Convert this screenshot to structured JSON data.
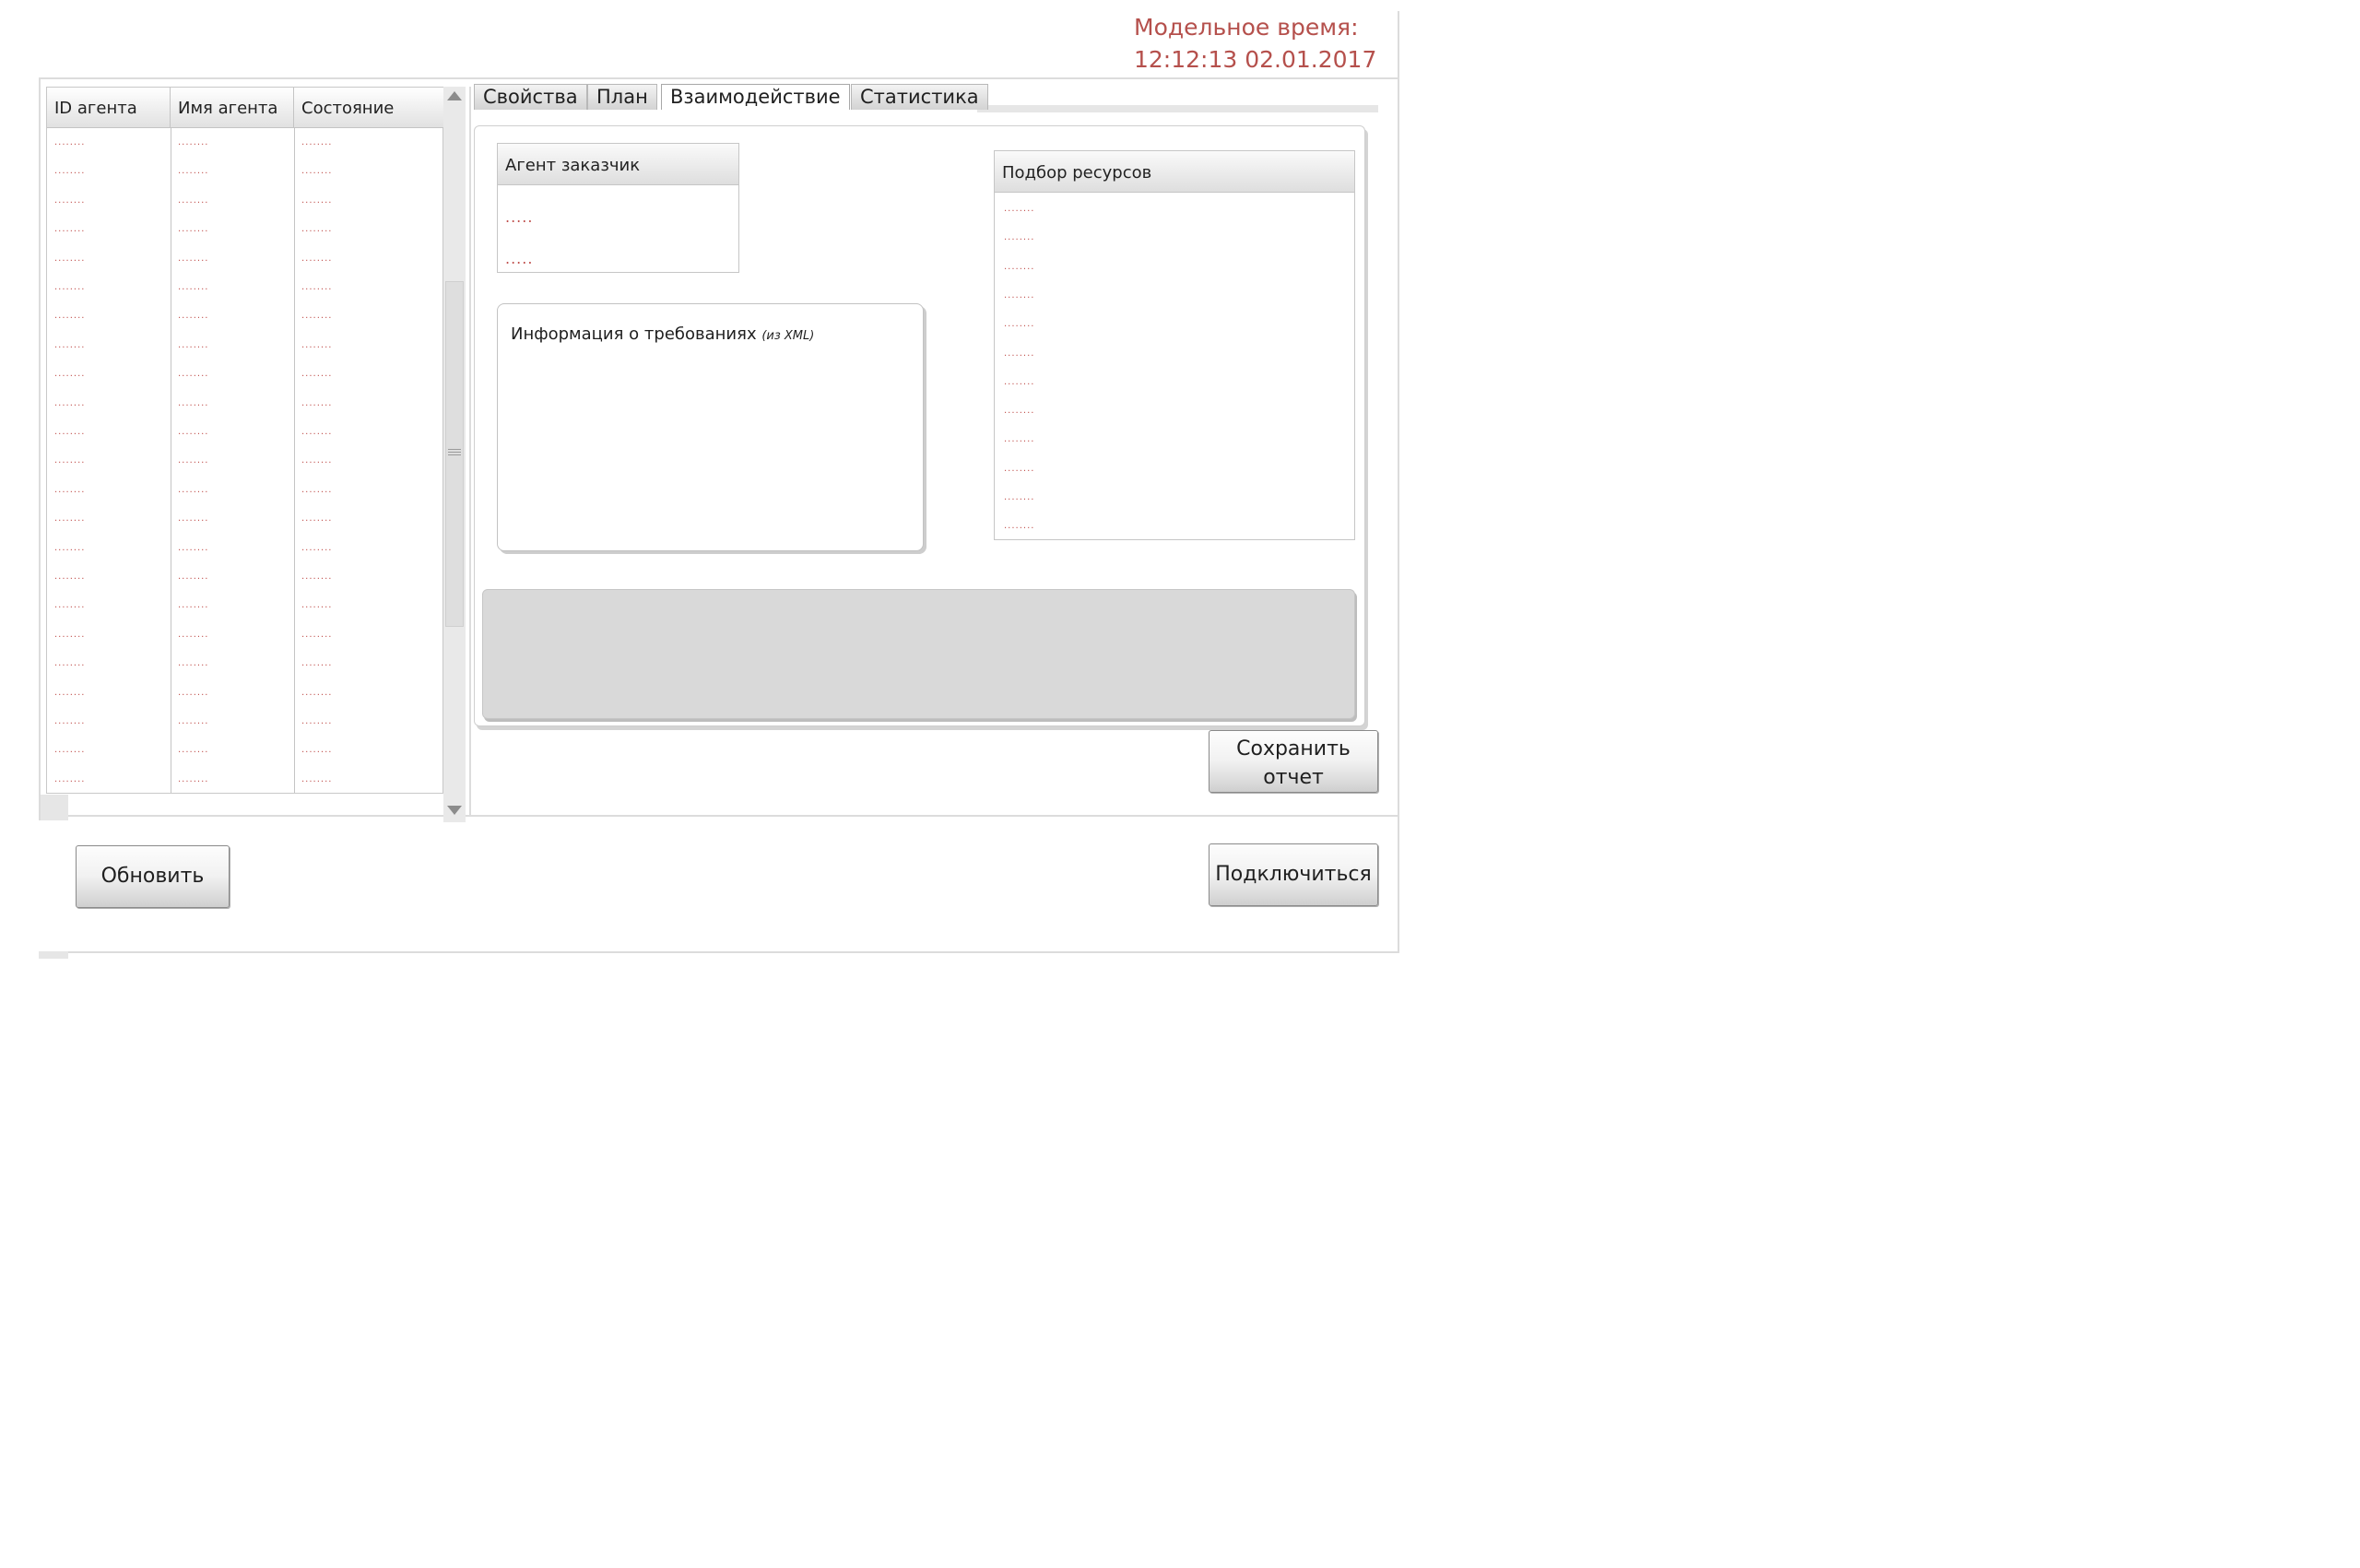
{
  "header": {
    "model_time_label": "Модельное время:",
    "model_time_value": "12:12:13 02.01.2017"
  },
  "agents_table": {
    "columns": [
      "ID агента",
      "Имя агента",
      "Состояние"
    ],
    "rows": [
      [
        "........",
        "........",
        "........"
      ],
      [
        "........",
        "........",
        "........"
      ],
      [
        "........",
        "........",
        "........"
      ],
      [
        "........",
        "........",
        "........"
      ],
      [
        "........",
        "........",
        "........"
      ],
      [
        "........",
        "........",
        "........"
      ],
      [
        "........",
        "........",
        "........"
      ],
      [
        "........",
        "........",
        "........"
      ],
      [
        "........",
        "........",
        "........"
      ],
      [
        "........",
        "........",
        "........"
      ],
      [
        "........",
        "........",
        "........"
      ],
      [
        "........",
        "........",
        "........"
      ],
      [
        "........",
        "........",
        "........"
      ],
      [
        "........",
        "........",
        "........"
      ],
      [
        "........",
        "........",
        "........"
      ],
      [
        "........",
        "........",
        "........"
      ],
      [
        "........",
        "........",
        "........"
      ],
      [
        "........",
        "........",
        "........"
      ],
      [
        "........",
        "........",
        "........"
      ],
      [
        "........",
        "........",
        "........"
      ],
      [
        "........",
        "........",
        "........"
      ],
      [
        "........",
        "........",
        "........"
      ],
      [
        "........",
        "........",
        "........"
      ]
    ]
  },
  "tabs": [
    {
      "label": "Свойства"
    },
    {
      "label": "План"
    },
    {
      "label": "Взаимодействие",
      "active": true
    },
    {
      "label": "Статистика"
    }
  ],
  "customer_agent": {
    "title": "Агент заказчик",
    "values": [
      ".....",
      "....."
    ]
  },
  "requirements": {
    "title": "Информация о требованиях",
    "source_note": "(из XML)"
  },
  "resource_selection": {
    "title": "Подбор ресурсов",
    "items": [
      "........",
      "........",
      "........",
      "........",
      "........",
      "........",
      "........",
      "........",
      "........",
      "........",
      "........",
      "........"
    ]
  },
  "buttons": {
    "save_report": [
      "Сохранить",
      "отчет"
    ],
    "refresh": "Обновить",
    "connect": "Подключиться"
  },
  "colors": {
    "accent_text": "#b5504c",
    "placeholder_dots": "#c0504d"
  }
}
